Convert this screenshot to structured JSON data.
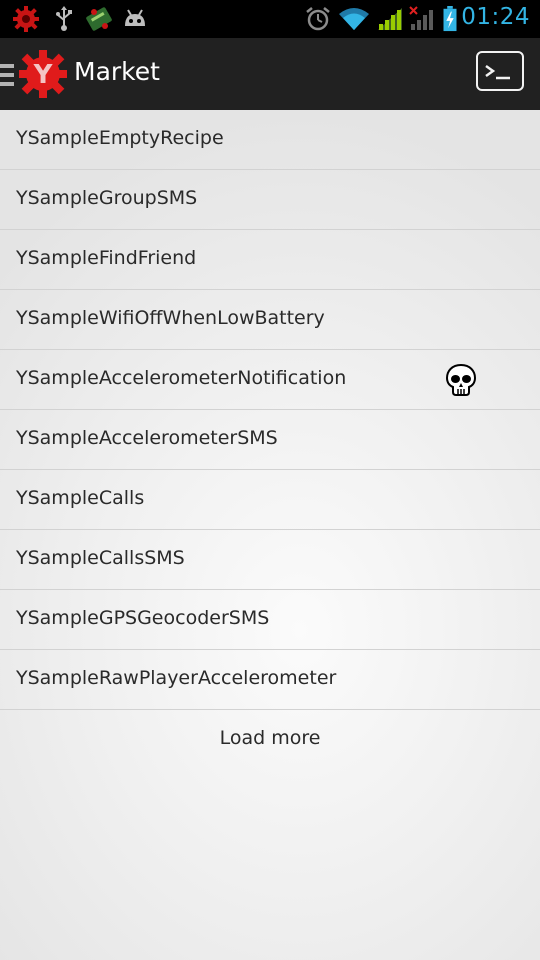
{
  "status_bar": {
    "time": "01:24",
    "time_color": "#33b5e5",
    "icons_left": [
      "gear-notification-icon",
      "usb-icon",
      "app-notification-icon",
      "android-debug-icon"
    ],
    "icons_right": [
      "alarm-icon",
      "wifi-icon",
      "signal-icon",
      "no-signal-icon",
      "battery-charging-icon"
    ]
  },
  "action_bar": {
    "title": "Market",
    "logo": "y-gear-logo",
    "logo_letter": "Y",
    "logo_color": "#e01b1b",
    "action_icon": "terminal-icon"
  },
  "list": {
    "items": [
      {
        "label": "YSampleEmptyRecipe"
      },
      {
        "label": "YSampleGroupSMS"
      },
      {
        "label": "YSampleFindFriend"
      },
      {
        "label": "YSampleWifiOffWhenLowBattery"
      },
      {
        "label": "YSampleAccelerometerNotification",
        "badge_icon": "skull-icon"
      },
      {
        "label": "YSampleAccelerometerSMS"
      },
      {
        "label": "YSampleCalls"
      },
      {
        "label": "YSampleCallsSMS"
      },
      {
        "label": "YSampleGPSGeocoderSMS"
      },
      {
        "label": "YSampleRawPlayerAccelerometer"
      }
    ],
    "load_more_label": "Load more"
  }
}
